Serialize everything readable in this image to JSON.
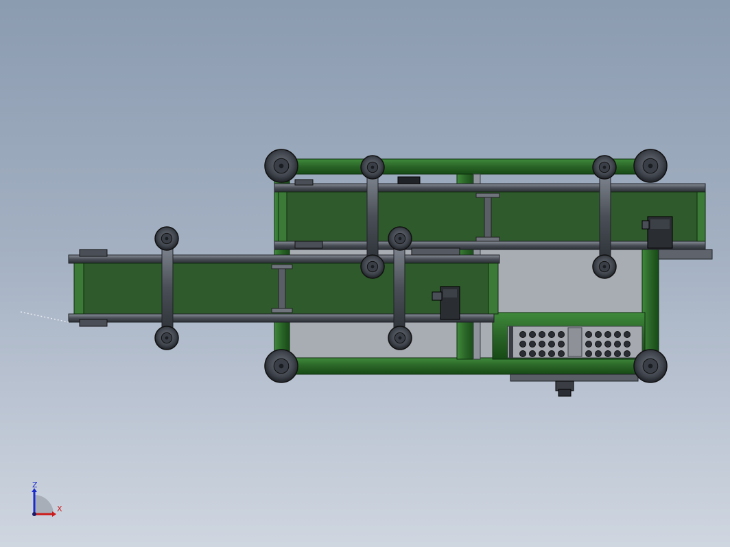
{
  "triad": {
    "z_label": "Z",
    "x_label": "X",
    "z_color": "#1a2acc",
    "x_color": "#cc1a1a"
  },
  "colors": {
    "frame_green": "#2f6a2c",
    "frame_green_dark": "#174a16",
    "belt_green": "#2c5a2a",
    "steel": "#3a3f48",
    "steel_light": "#6b717b",
    "wheel_outer": "#4a4f57",
    "wheel_inner": "#2a2e34",
    "panel_grey": "#a8abb1"
  },
  "icons": {
    "triad": "axis-triad-icon",
    "caster": "caster-wheel-icon",
    "motor": "gear-motor-icon"
  }
}
